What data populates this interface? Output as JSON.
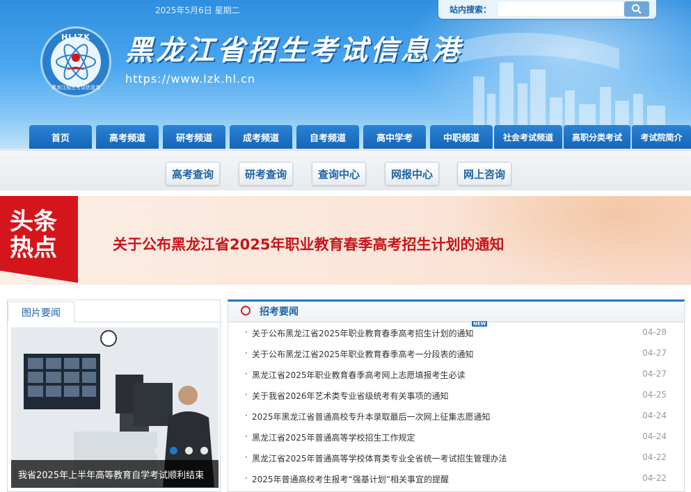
{
  "header": {
    "date": "2025年5月6日  星期二",
    "search_label": "站内搜索：",
    "search_placeholder": "",
    "logo_top": "HLJZK",
    "logo_bottom": "黑龙江招生考试信息港",
    "site_title": "黑龙江省招生考试信息港",
    "site_url": "https://www.lzk.hl.cn"
  },
  "nav": [
    "首页",
    "高考频道",
    "研考频道",
    "成考频道",
    "自考频道",
    "高中学考",
    "中职频道",
    "社会考试频道",
    "高职分类考试",
    "考试院简介"
  ],
  "quick_links": [
    "高考查询",
    "研考查询",
    "查询中心",
    "网报中心",
    "网上咨询"
  ],
  "headline": {
    "badge_line1": "头条",
    "badge_line2": "热点",
    "text": "关于公布黑龙江省2025年职业教育春季高考招生计划的通知"
  },
  "picture_news": {
    "tab": "图片要闻",
    "caption": "我省2025年上半年高等教育自学考试顺利结束"
  },
  "news": {
    "title": "招考要闻",
    "new_tag": "NEW",
    "items": [
      {
        "title": "关于公布黑龙江省2025年职业教育春季高考招生计划的通知",
        "date": "04-28"
      },
      {
        "title": "关于公布黑龙江省2025年职业教育春季高考一分段表的通知",
        "date": "04-27"
      },
      {
        "title": "黑龙江省2025年职业教育春季高考网上志愿填报考生必读",
        "date": "04-27"
      },
      {
        "title": "关于我省2026年艺术类专业省级统考有关事项的通知",
        "date": "04-25"
      },
      {
        "title": "2025年黑龙江省普通高校专升本录取最后一次网上征集志愿通知",
        "date": "04-24"
      },
      {
        "title": "黑龙江省2025年普通高等学校招生工作规定",
        "date": "04-24"
      },
      {
        "title": "黑龙江省2025年普通高等学校体育类专业全省统一考试招生管理办法",
        "date": "04-22"
      },
      {
        "title": "2025年普通高校考生报考“强基计划”相关事宜的提醒",
        "date": "04-22"
      }
    ]
  },
  "colors": {
    "nav_blue": "#1565b8",
    "headline_red": "#c8141a",
    "link_blue": "#1e63a8"
  }
}
